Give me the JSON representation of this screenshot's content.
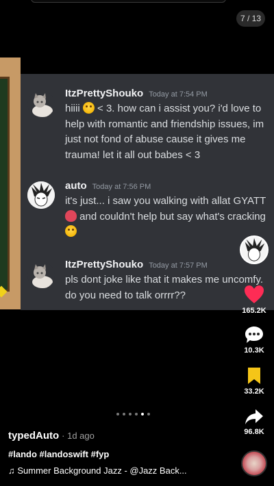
{
  "page_indicator": "7 / 13",
  "messages": [
    {
      "username": "ItzPrettyShouko",
      "timestamp": "Today at 7:54 PM",
      "lines": [
        {
          "pre": "hiiii ",
          "emoji": "smile",
          "post": "  < 3. how can i assist you? i'd love to"
        },
        {
          "text": "help with romantic and friendship issues, im"
        },
        {
          "text": "just not fond of abuse cause it gives me"
        },
        {
          "text": "trauma! let it all out babes < 3"
        }
      ]
    },
    {
      "username": "auto",
      "timestamp": "Today at 7:56 PM",
      "lines": [
        {
          "text": "it's just... i saw you walking with allat GYATT"
        },
        {
          "emoji": "broken-heart",
          "post": " and couldn't help but say what's cracking"
        },
        {
          "emoji": "grin"
        }
      ]
    },
    {
      "username": "ItzPrettyShouko",
      "timestamp": "Today at 7:57 PM",
      "lines": [
        {
          "text": "pls dont joke like that it makes me uncomfy."
        },
        {
          "text": "do you need to talk orrrr??"
        }
      ]
    }
  ],
  "actions": {
    "likes": "165.2K",
    "comments": "10.3K",
    "saves": "33.2K",
    "shares": "96.8K"
  },
  "post": {
    "author": "typedAuto",
    "ago": "· 1d ago",
    "hashtags": "#lando #landoswift #fyp",
    "music_note": "♫",
    "music": "Summer Background Jazz - @Jazz Back..."
  },
  "colors": {
    "chat_bg": "#313338",
    "like": "#fe2c55",
    "save": "#f5c518"
  },
  "carousel": {
    "total_dots": 6,
    "active_dot": 5
  }
}
